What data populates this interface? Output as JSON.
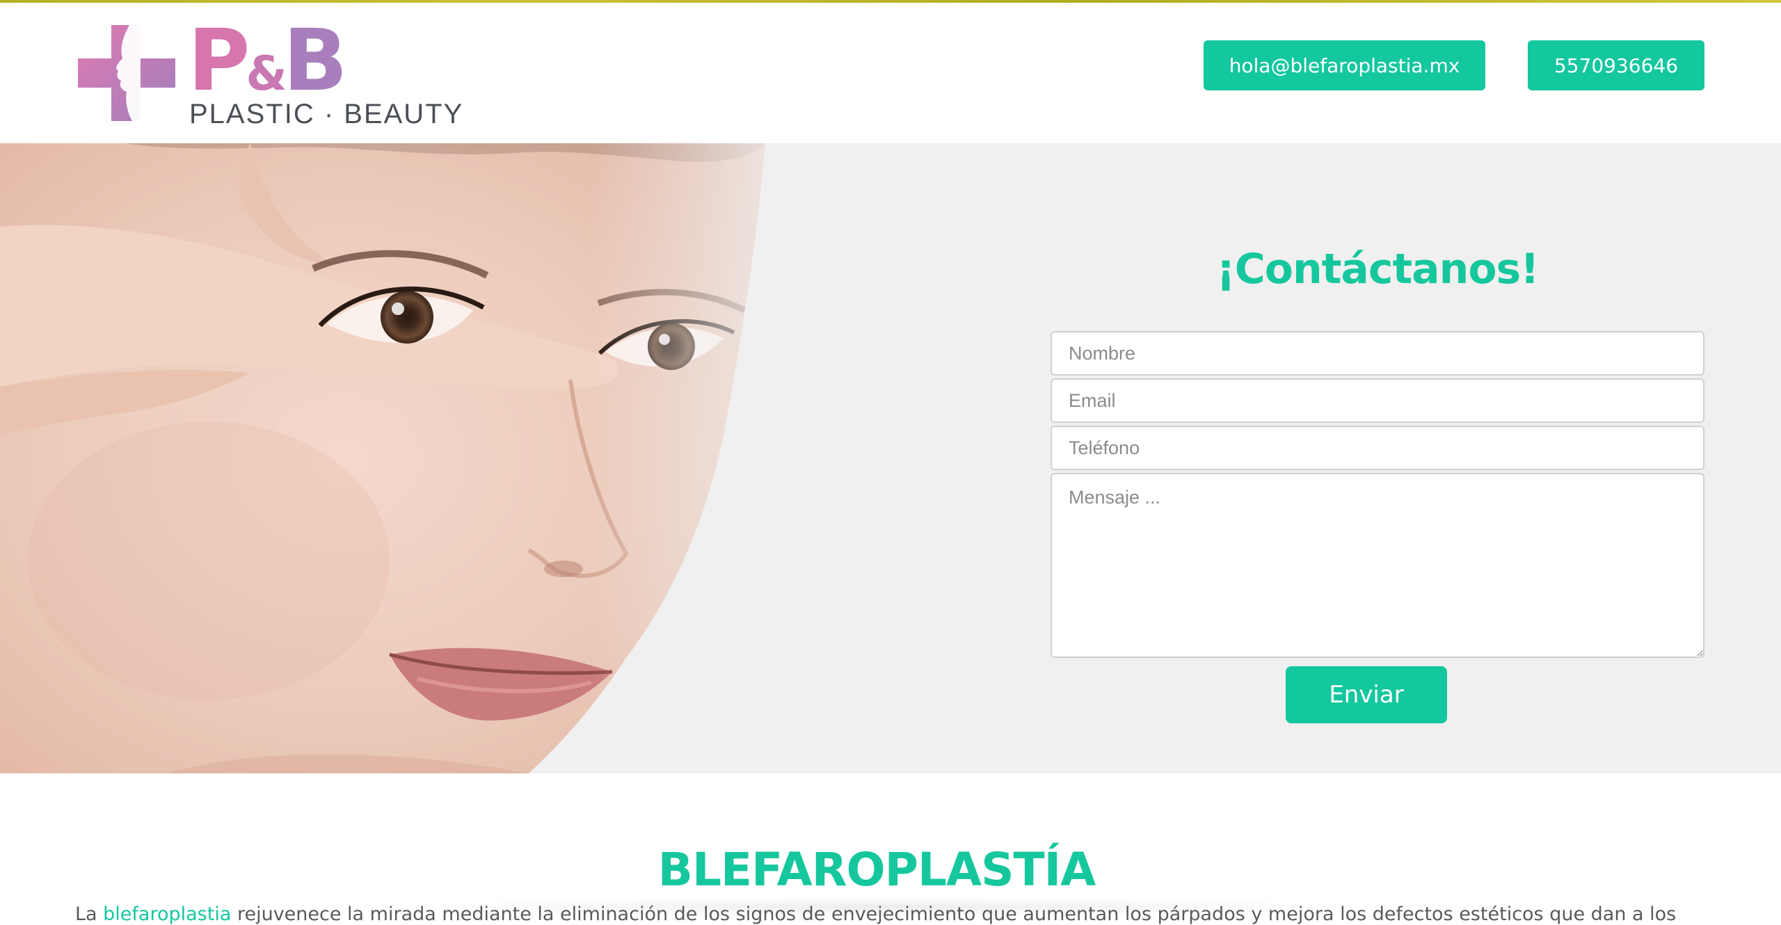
{
  "brand": {
    "logo_letters": {
      "p": "P",
      "amp": "&",
      "b": "B"
    },
    "logo_tagline": "PLASTIC · BEAUTY"
  },
  "header": {
    "email_button": "hola@blefaroplastia.mx",
    "phone_button": "5570936646"
  },
  "contact": {
    "title": "¡Contáctanos!",
    "fields": {
      "name_placeholder": "Nombre",
      "email_placeholder": "Email",
      "phone_placeholder": "Teléfono",
      "message_placeholder": "Mensaje ..."
    },
    "submit_label": "Enviar"
  },
  "section": {
    "title": "BLEFAROPLASTÍA",
    "intro_prefix": "La ",
    "intro_highlight": "blefaroplastia",
    "intro_rest": " rejuvenece la mirada mediante la eliminación de los signos de envejecimiento que aumentan los párpados y mejora los defectos estéticos que dan a los"
  },
  "colors": {
    "accent": "#13c79e",
    "logo_pink": "#d676ad",
    "logo_purple": "#a87fbc",
    "hero_bg": "#f0f0f0"
  },
  "icons": {
    "logo_mark": "medical-cross-face-profile-icon"
  }
}
